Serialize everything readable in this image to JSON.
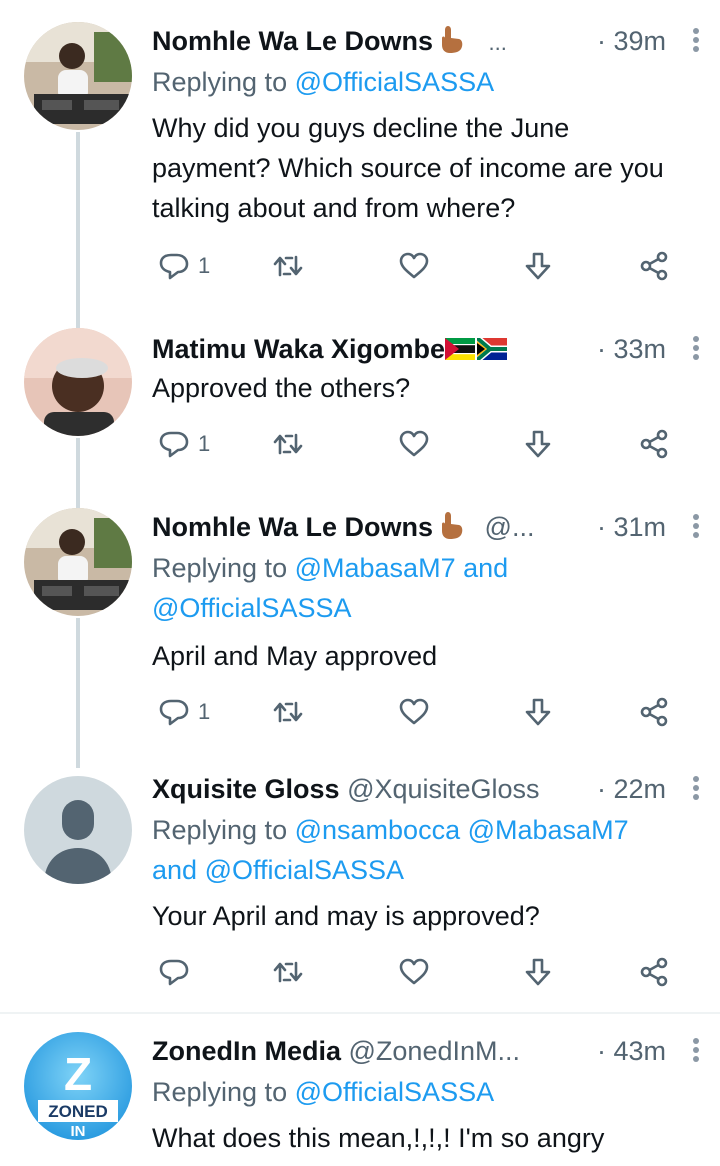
{
  "tweets": [
    {
      "name": "Nomhle Wa Le Downs",
      "handle": "...",
      "time": "· 39m",
      "replying_prefix": "Replying to",
      "mentions": [
        "@OfficialSASSA"
      ],
      "text": "Why did you guys decline the June payment? Which source of income are you talking about and from where?",
      "reply_count": "1"
    },
    {
      "name": "Matimu Waka Xigombe",
      "handle": "",
      "time": "· 33m",
      "text": "Approved the others?",
      "reply_count": "1"
    },
    {
      "name": "Nomhle Wa Le Downs",
      "handle": "@...",
      "time": "· 31m",
      "replying_prefix": "Replying to",
      "mentions": [
        "@MabasaM7",
        "and",
        "@OfficialSASSA"
      ],
      "text": "April and May approved",
      "reply_count": "1"
    },
    {
      "name": "Xquisite Gloss",
      "handle": "@XquisiteGloss",
      "time": "· 22m",
      "replying_prefix": "Replying to",
      "mentions": [
        "@nsambocca",
        "@MabasaM7",
        "and",
        "@OfficialSASSA"
      ],
      "text": "Your  April and may is approved?",
      "reply_count": ""
    },
    {
      "name": "ZonedIn Media",
      "handle": "@ZonedInM...",
      "time": "· 43m",
      "replying_prefix": "Replying to",
      "mentions": [
        "@OfficialSASSA"
      ],
      "text": "What does this mean,!,!,! I'm so angry",
      "avatar_text_top": "Z",
      "avatar_text_mid": "ZONED",
      "avatar_text_bot": "IN"
    }
  ],
  "icons": {
    "reply": "reply-icon",
    "retweet": "retweet-icon",
    "like": "heart-icon",
    "bookmark": "bookmark-icon",
    "share": "share-icon"
  },
  "colors": {
    "accent": "#1d9bf0",
    "secondary_text": "#536471",
    "thread_line": "#cfd9de"
  }
}
